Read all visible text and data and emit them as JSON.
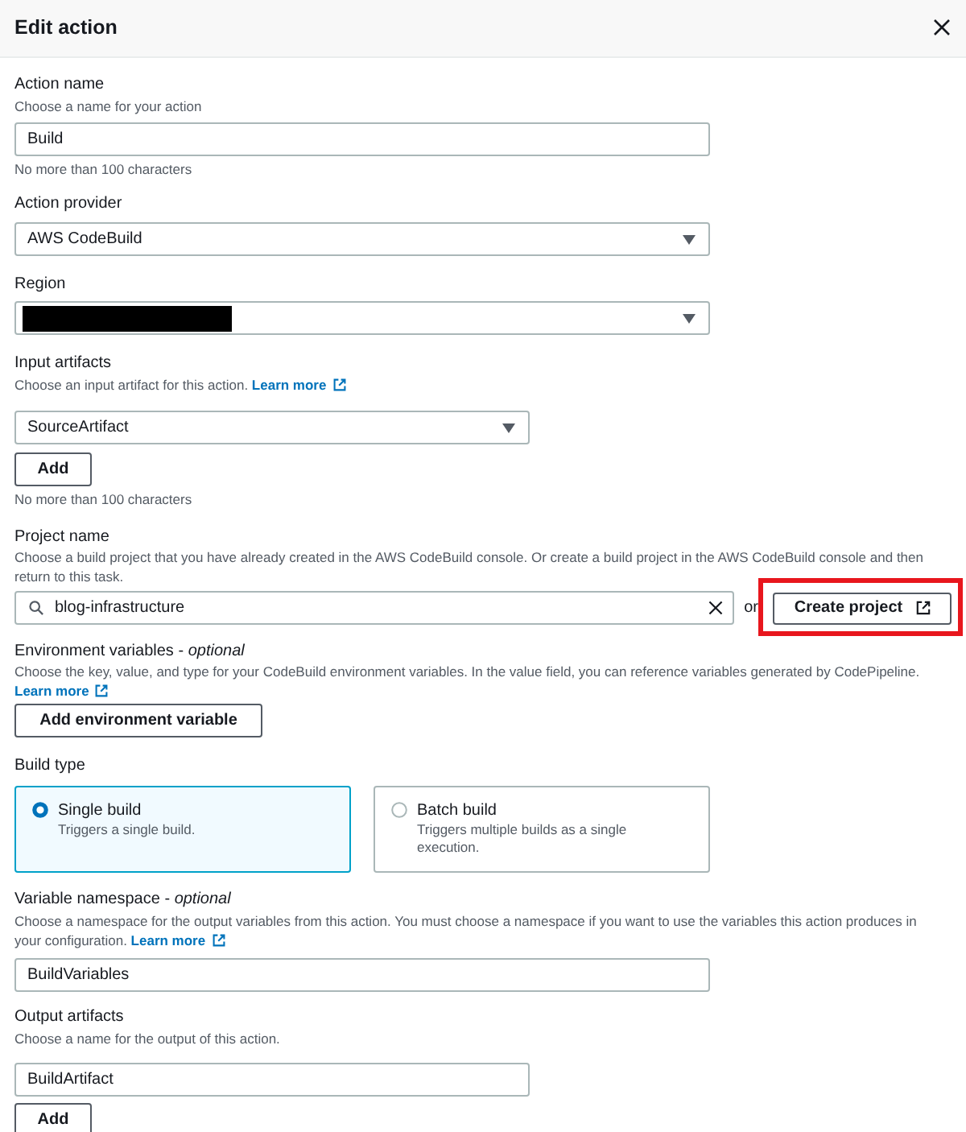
{
  "dialog": {
    "title": "Edit action"
  },
  "action_name": {
    "label": "Action name",
    "description": "Choose a name for your action",
    "value": "Build",
    "constraint": "No more than 100 characters"
  },
  "action_provider": {
    "label": "Action provider",
    "value": "AWS CodeBuild"
  },
  "region": {
    "label": "Region",
    "redacted": true
  },
  "input_artifacts": {
    "label": "Input artifacts",
    "description": "Choose an input artifact for this action.",
    "link": "Learn more",
    "value": "SourceArtifact",
    "button": "Add",
    "constraint": "No more than 100 characters"
  },
  "project_name": {
    "label": "Project name",
    "description": "Choose a build project that you have already created in the AWS CodeBuild console. Or create a build project in the AWS CodeBuild console and then return to this task.",
    "value": "blog-infrastructure",
    "separator": "or",
    "button": {
      "label": "Create project",
      "highlighted": true
    }
  },
  "environment_variables": {
    "label": "Environment variables - *optional*",
    "description": "Choose the key, value, and type for your CodeBuild environment variables. In the value field, you can reference variables generated by CodePipeline.",
    "link": "Learn more",
    "button": "Add environment variable"
  },
  "build_type": {
    "label": "Build type",
    "options": [
      {
        "title": "Single build",
        "description": "Triggers a single build.",
        "selected": true
      },
      {
        "title": "Batch build",
        "description": "Triggers multiple builds as a single execution.",
        "selected": false
      }
    ]
  },
  "variable_namespace": {
    "label": "Variable namespace - *optional*",
    "description": "Choose a namespace for the output variables from this action. You must choose a namespace if you want to use the variables this action produces in your configuration.",
    "link": "Learn more",
    "value": "BuildVariables"
  },
  "output_artifacts": {
    "label": "Output artifacts",
    "description": "Choose a name for the output of this action.",
    "value": "BuildArtifact",
    "button": "Add"
  }
}
